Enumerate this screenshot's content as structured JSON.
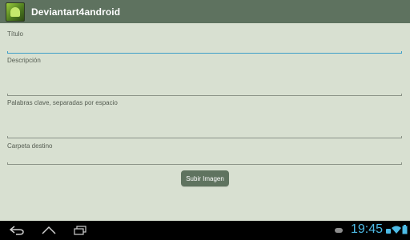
{
  "app": {
    "title": "Deviantart4android",
    "icon": "deviantart-android-app-icon"
  },
  "form": {
    "titulo_label": "Título",
    "descripcion_label": "Descripción",
    "palabras_label": "Palabras clave, separadas por espacio",
    "carpeta_label": "Carpeta destino",
    "submit_label": "Subir Imagen"
  },
  "navbar": {
    "back_icon": "back-icon",
    "home_icon": "home-icon",
    "recents_icon": "recent-apps-icon"
  },
  "status": {
    "time": "19:45",
    "icons": [
      "game-controller-icon",
      "android-debug-icon",
      "wifi-icon",
      "battery-icon"
    ]
  },
  "colors": {
    "actionbar": "#5e725f",
    "background": "#d8e0d1",
    "accent": "#3f9fc9",
    "clock": "#4dbbe6"
  }
}
